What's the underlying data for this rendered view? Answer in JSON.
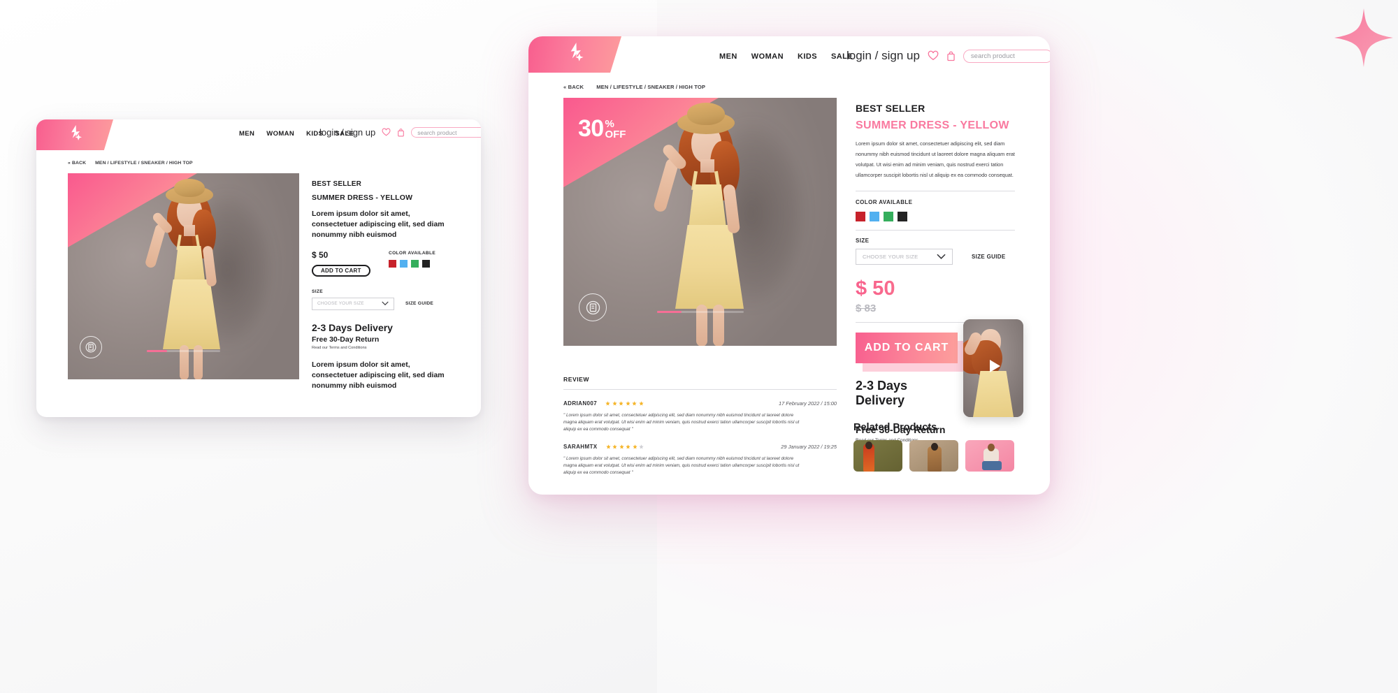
{
  "brand": {
    "logo_icon": "lightning-star-logo"
  },
  "header": {
    "nav": [
      {
        "label": "MEN"
      },
      {
        "label": "WOMAN"
      },
      {
        "label": "KIDS"
      },
      {
        "label": "SALE"
      }
    ],
    "login_label": "login / sign up",
    "wishlist_icon": "heart-icon",
    "bag_icon": "shopping-bag-icon",
    "search_placeholder": "search product",
    "search_value": "",
    "search_icon": "search-icon"
  },
  "breadcrumb": {
    "back_label": "« BACK",
    "path": "MEN / LIFESTYLE / SNEAKER / HIGH TOP"
  },
  "hero": {
    "discount_number": "30",
    "discount_percent": "%",
    "discount_off": "OFF",
    "seal_icon": "guarantee-seal-icon",
    "slider_icon": "slider-progress"
  },
  "product": {
    "kicker": "BEST SELLER",
    "title": "SUMMER DRESS - YELLOW",
    "description": "Lorem ipsum dolor sit amet, consectetuer adipiscing elit, sed diam nonummy nibh euismod tincidunt ut laoreet dolore magna aliquam erat volutpat. Ut wisi enim ad minim veniam, quis nostrud exerci tation ullamcorper suscipit lobortis nisl ut aliquip ex ea commodo consequat.",
    "description_short": "Lorem ipsum dolor sit amet, consectetuer adipiscing elit, sed diam nonummy nibh euismod",
    "color_label": "COLOR AVAILABLE",
    "colors": [
      {
        "name": "red",
        "hex": "#c7222b"
      },
      {
        "name": "blue",
        "hex": "#52b0f0"
      },
      {
        "name": "green",
        "hex": "#35ae5c"
      },
      {
        "name": "black",
        "hex": "#232323"
      }
    ],
    "size_label": "SIZE",
    "size_placeholder": "CHOOSE YOUR SIZE",
    "size_chevron_icon": "chevron-down-icon",
    "size_guide_label": "SIZE GUIDE",
    "price_current": "$ 50",
    "price_old": "$ 83",
    "add_to_cart_label": "ADD TO CART",
    "delivery_title": "2-3 Days Delivery",
    "return_title": "Free 30-Day Return",
    "return_note": "Read our Terms and Conditions",
    "video_thumb_icon": "play-icon",
    "accent_color": "#f8618d",
    "cta_gradient_from": "#f85f8f",
    "cta_gradient_to": "#fd9f9c"
  },
  "review": {
    "heading": "REVIEW",
    "items": [
      {
        "user": "ADRIAN007",
        "stars_filled": 6,
        "stars_total": 6,
        "date": "17 February 2022 / 15:00",
        "text": "\" Lorem ipsum dolor sit amet, consectetuer adipiscing elit, sed diam nonummy nibh euismod tincidunt ut laoreet dolore magna aliquam erat volutpat. Ut wisi enim ad minim veniam, quis nostrud exerci tation ullamcorper suscipit lobortis nisl ut aliquip ex ea commodo consequat \""
      },
      {
        "user": "SARAHMTX",
        "stars_filled": 5,
        "stars_total": 6,
        "date": "29 January 2022 / 19:25",
        "text": "\" Lorem ipsum dolor sit amet, consectetuer adipiscing elit, sed diam nonummy nibh euismod tincidunt ut laoreet dolore magna aliquam erat volutpat. Ut wisi enim ad minim veniam, quis nostrud exerci tation ullamcorper suscipit lobortis nisl ut aliquip ex ea commodo consequat \""
      }
    ],
    "star_color": "#f5b52a",
    "star_empty_color": "#cfcfd4"
  },
  "related": {
    "heading": "Related Products",
    "items": [
      {
        "name": "related-product-olive"
      },
      {
        "name": "related-product-tan"
      },
      {
        "name": "related-product-pink"
      }
    ]
  },
  "decor": {
    "sparkle_icon": "sparkle-icon"
  }
}
